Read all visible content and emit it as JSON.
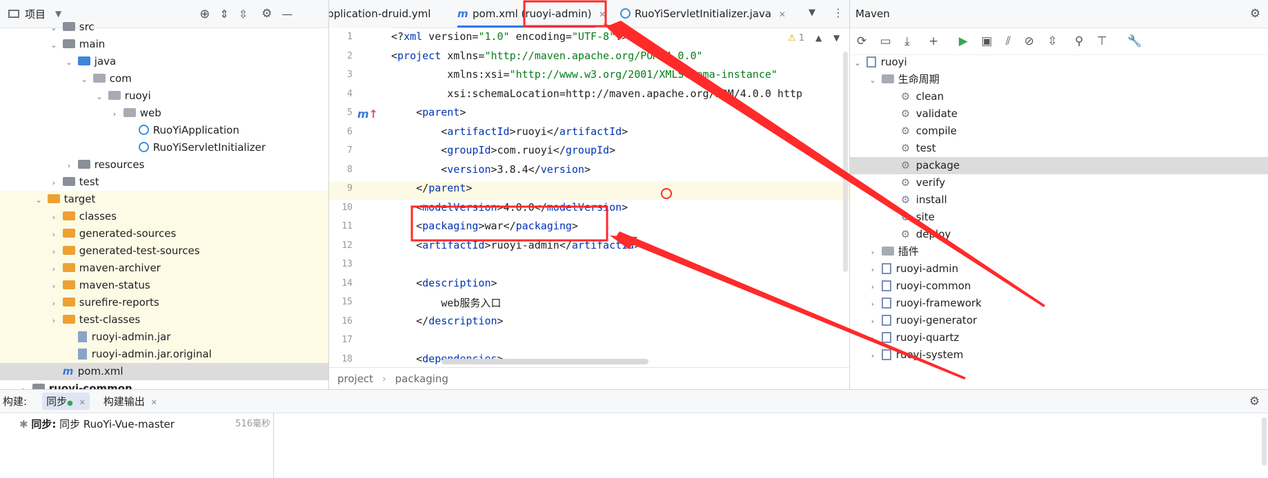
{
  "project": {
    "title": "项目",
    "tree": [
      {
        "label": "src",
        "depth": 3,
        "type": "folder-g",
        "expanded": true
      },
      {
        "label": "main",
        "depth": 3,
        "type": "folder-g",
        "expanded": true
      },
      {
        "label": "java",
        "depth": 4,
        "type": "folder-b",
        "expanded": true
      },
      {
        "label": "com",
        "depth": 5,
        "type": "folder-pk",
        "expanded": true
      },
      {
        "label": "ruoyi",
        "depth": 6,
        "type": "folder-pk",
        "expanded": true
      },
      {
        "label": "web",
        "depth": 7,
        "type": "folder-pk",
        "expanded": false
      },
      {
        "label": "RuoYiApplication",
        "depth": 8,
        "type": "class"
      },
      {
        "label": "RuoYiServletInitializer",
        "depth": 8,
        "type": "class"
      },
      {
        "label": "resources",
        "depth": 4,
        "type": "folder-g",
        "expanded": false
      },
      {
        "label": "test",
        "depth": 3,
        "type": "folder-g",
        "expanded": false
      },
      {
        "label": "target",
        "depth": 2,
        "type": "folder-o",
        "expanded": true
      },
      {
        "label": "classes",
        "depth": 3,
        "type": "folder-o",
        "expanded": false
      },
      {
        "label": "generated-sources",
        "depth": 3,
        "type": "folder-o",
        "expanded": false
      },
      {
        "label": "generated-test-sources",
        "depth": 3,
        "type": "folder-o",
        "expanded": false
      },
      {
        "label": "maven-archiver",
        "depth": 3,
        "type": "folder-o",
        "expanded": false
      },
      {
        "label": "maven-status",
        "depth": 3,
        "type": "folder-o",
        "expanded": false
      },
      {
        "label": "surefire-reports",
        "depth": 3,
        "type": "folder-o",
        "expanded": false
      },
      {
        "label": "test-classes",
        "depth": 3,
        "type": "folder-o",
        "expanded": false
      },
      {
        "label": "ruoyi-admin.jar",
        "depth": 4,
        "type": "jar"
      },
      {
        "label": "ruoyi-admin.jar.original",
        "depth": 4,
        "type": "jar"
      },
      {
        "label": "pom.xml",
        "depth": 3,
        "type": "maven"
      },
      {
        "label": "ruoyi-common",
        "depth": 1,
        "type": "folder-g",
        "expanded": false
      }
    ]
  },
  "editor": {
    "tabs": [
      {
        "label": "application-druid.yml",
        "display": "application-druid.yml"
      },
      {
        "label": "pom.xml (ruoyi-admin)"
      },
      {
        "label": "RuoYiServletInitializer.java"
      }
    ],
    "warning_count": "1",
    "breadcrumb": [
      "project",
      "packaging"
    ],
    "lines": [
      {
        "n": "1",
        "text": "<?xml version=\"1.0\" encoding=\"UTF-8\"?>"
      },
      {
        "n": "2",
        "text": "<project xmlns=\"http://maven.apache.org/POM/4.0.0\""
      },
      {
        "n": "3",
        "text": "         xmlns:xsi=\"http://www.w3.org/2001/XMLSchema-instance\""
      },
      {
        "n": "4",
        "text": "         xsi:schemaLocation=\"http://maven.apache.org/POM/4.0.0 http"
      },
      {
        "n": "5",
        "text": "    <parent>"
      },
      {
        "n": "6",
        "text": "        <artifactId>ruoyi</artifactId>"
      },
      {
        "n": "7",
        "text": "        <groupId>com.ruoyi</groupId>"
      },
      {
        "n": "8",
        "text": "        <version>3.8.4</version>"
      },
      {
        "n": "9",
        "text": "    </parent>"
      },
      {
        "n": "10",
        "text": "    <modelVersion>4.0.0</modelVersion>"
      },
      {
        "n": "11",
        "text": "    <packaging>war</packaging>"
      },
      {
        "n": "12",
        "text": "    <artifactId>ruoyi-admin</artifactId>"
      },
      {
        "n": "13",
        "text": ""
      },
      {
        "n": "14",
        "text": "    <description>"
      },
      {
        "n": "15",
        "text": "        web服务入口"
      },
      {
        "n": "16",
        "text": "    </description>"
      },
      {
        "n": "17",
        "text": ""
      },
      {
        "n": "18",
        "text": "    <dependencies>"
      }
    ]
  },
  "maven": {
    "title": "Maven",
    "root": "ruoyi",
    "lifecycle_label": "生命周期",
    "lifecycle": [
      "clean",
      "validate",
      "compile",
      "test",
      "package",
      "verify",
      "install",
      "site",
      "deploy"
    ],
    "selected": "package",
    "plugins_label": "插件",
    "modules": [
      "ruoyi-admin",
      "ruoyi-common",
      "ruoyi-framework",
      "ruoyi-generator",
      "ruoyi-quartz",
      "ruoyi-system"
    ]
  },
  "build": {
    "title": "构建:",
    "tabs": [
      "同步",
      "构建输出"
    ],
    "sync_label": "同步:",
    "sync_text": "同步 RuoYi-Vue-master",
    "duration": "516毫秒"
  },
  "colors": {
    "annotation": "#ff2a2a"
  }
}
